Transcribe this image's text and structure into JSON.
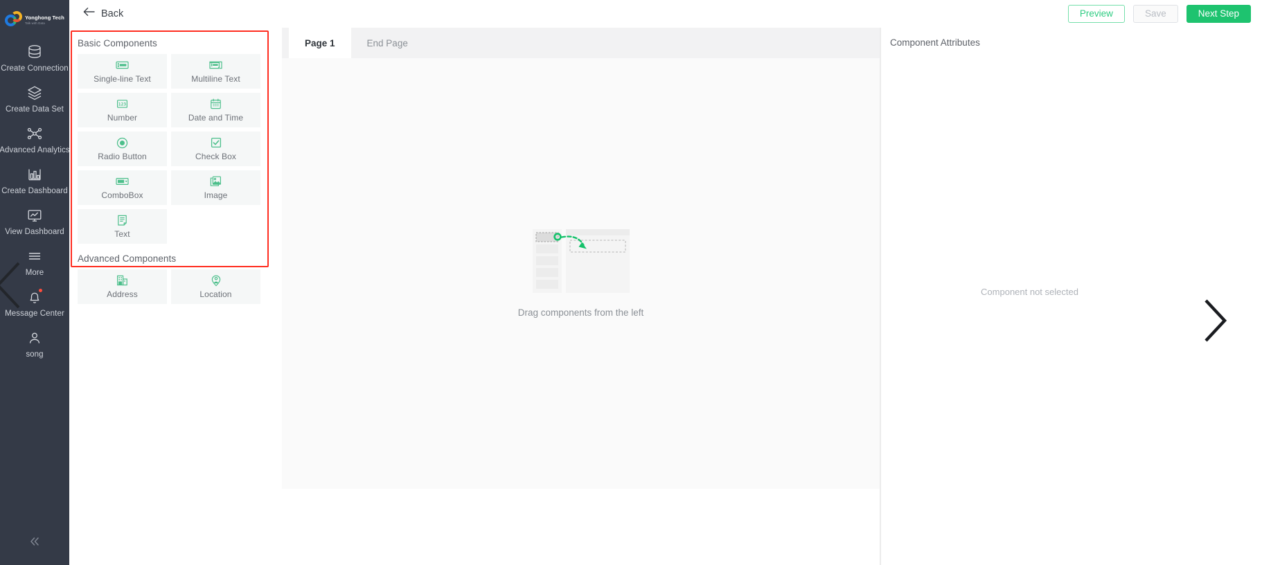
{
  "nav": {
    "logo": {
      "name": "Yonghong Tech",
      "tagline": "Talk with Data",
      "icon": "yonghong-logo-icon"
    },
    "items": [
      {
        "label": "Create Connection",
        "icon": "database-icon",
        "badge": false
      },
      {
        "label": "Create Data Set",
        "icon": "layers-icon",
        "badge": false
      },
      {
        "label": "Advanced Analytics",
        "icon": "nodes-icon",
        "badge": false
      },
      {
        "label": "Create Dashboard",
        "icon": "bar-chart-icon",
        "badge": false
      },
      {
        "label": "View Dashboard",
        "icon": "monitor-chart-icon",
        "badge": false
      },
      {
        "label": "More",
        "icon": "hamburger-icon",
        "badge": false
      },
      {
        "label": "Message Center",
        "icon": "bell-icon",
        "badge": true
      },
      {
        "label": "song",
        "icon": "user-icon",
        "badge": false
      }
    ],
    "collapse_icon": "double-chevron-left-icon"
  },
  "topbar": {
    "back_label": "Back",
    "back_icon": "arrow-left-icon",
    "preview_label": "Preview",
    "save_label": "Save",
    "next_label": "Next Step",
    "colors": {
      "primary": "#1ec36f",
      "ghost_text": "#2ecc82",
      "disabled": "#b9bdc4"
    }
  },
  "components_panel": {
    "highlight_color": "#ff2d20",
    "basic_title": "Basic Components",
    "advanced_title": "Advanced Components",
    "basic": [
      {
        "label": "Single-line Text",
        "icon": "single-line-text-icon"
      },
      {
        "label": "Multiline Text",
        "icon": "multiline-text-icon"
      },
      {
        "label": "Number",
        "icon": "number-123-icon"
      },
      {
        "label": "Date and Time",
        "icon": "calendar-icon"
      },
      {
        "label": "Radio Button",
        "icon": "radio-button-icon"
      },
      {
        "label": "Check Box",
        "icon": "check-box-icon"
      },
      {
        "label": "ComboBox",
        "icon": "combobox-icon"
      },
      {
        "label": "Image",
        "icon": "image-icon"
      },
      {
        "label": "Text",
        "icon": "text-document-icon"
      }
    ],
    "advanced": [
      {
        "label": "Address",
        "icon": "building-icon"
      },
      {
        "label": "Location",
        "icon": "location-pin-icon"
      }
    ]
  },
  "canvas": {
    "tabs": [
      {
        "label": "Page 1",
        "active": true
      },
      {
        "label": "End Page",
        "active": false
      }
    ],
    "empty_text": "Drag components from the left",
    "empty_icon": "drag-illustration-icon"
  },
  "attributes": {
    "title": "Component Attributes",
    "empty_text": "Component not selected",
    "chevron_icon": "chevron-right-icon"
  }
}
